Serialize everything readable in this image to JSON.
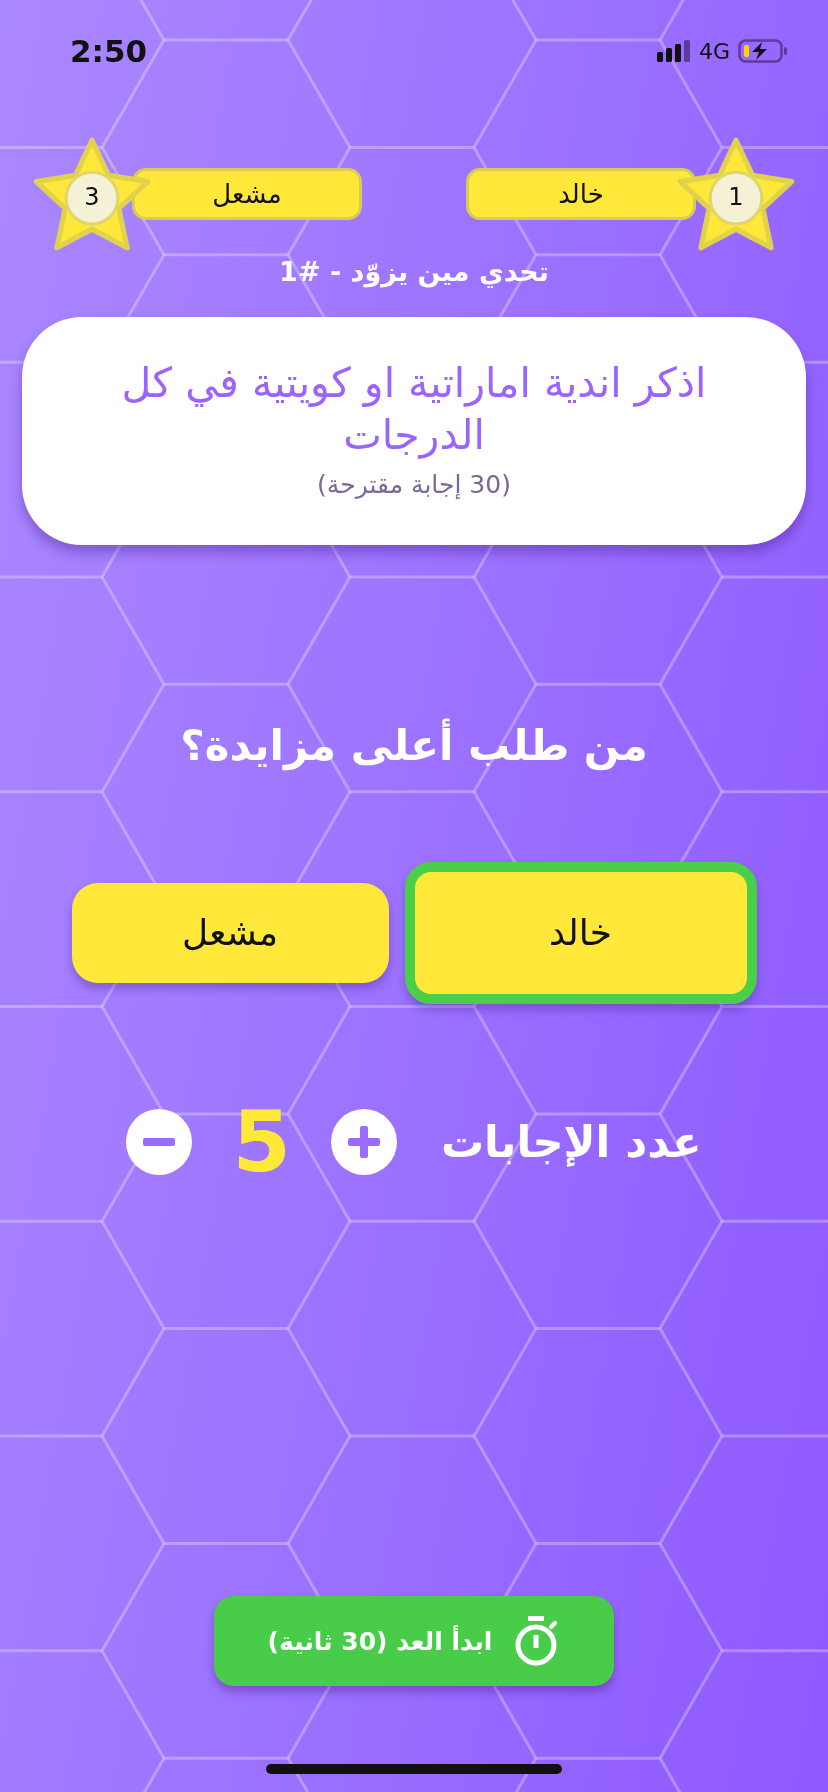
{
  "status_bar": {
    "time": "2:50",
    "network": "4G"
  },
  "players": [
    {
      "rank": "1",
      "name": "خالد"
    },
    {
      "rank": "3",
      "name": "مشعل"
    }
  ],
  "challenge_title": "تحدي مين يزوّد - #1",
  "question": {
    "text": "اذكر اندية اماراتية او كويتية في كل الدرجات",
    "hint": "(30 إجابة مقترحة)"
  },
  "prompt": "من طلب أعلى مزايدة؟",
  "bidders": [
    {
      "name": "خالد",
      "selected": true
    },
    {
      "name": "مشعل",
      "selected": false
    }
  ],
  "answer_count": {
    "label": "عدد الإجابات",
    "value": "5"
  },
  "start_button": {
    "label": "ابدأ العد (30 ثانية)"
  }
}
